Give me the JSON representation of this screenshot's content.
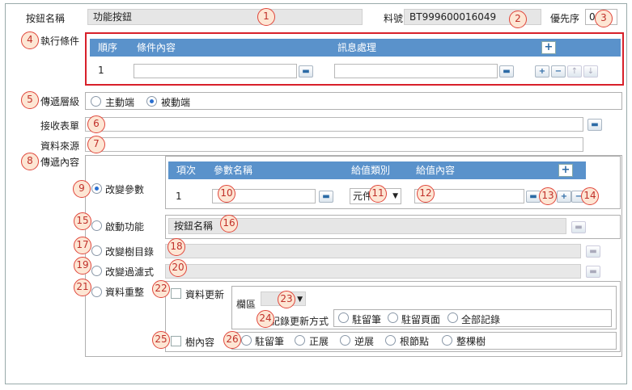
{
  "header": {
    "button_name_label": "按鈕名稱",
    "button_name_value": "功能按鈕",
    "material_no_label": "料號",
    "material_no_value": "BT999600016049",
    "priority_label": "優先序",
    "priority_value": "0"
  },
  "exec": {
    "label": "執行條件",
    "columns": [
      "順序",
      "條件內容",
      "訊息處理"
    ],
    "row_no": "1"
  },
  "layer": {
    "label": "傳遞層級",
    "options": [
      "主動端",
      "被動端"
    ]
  },
  "receive_form_label": "接收表單",
  "data_source_label": "資料來源",
  "content": {
    "label": "傳遞內容",
    "change_params": "改變參數",
    "param_columns": [
      "項次",
      "參數名稱",
      "給值類別",
      "給值內容"
    ],
    "param_row_no": "1",
    "value_type": "元件",
    "start_function": "啟動功能",
    "start_function_field": "按鈕名稱",
    "change_tree": "改變樹目錄",
    "change_filter": "改變過濾式",
    "data_reorg": "資料重整",
    "data_update": "資料更新",
    "section_label": "欄區",
    "record_update_label": "記錄更新方式",
    "record_options": [
      "駐留筆",
      "駐留頁面",
      "全部記錄"
    ],
    "tree_content": "樹內容",
    "tree_options": [
      "駐留筆",
      "正展",
      "逆展",
      "根節點",
      "整棵樹"
    ]
  },
  "callouts": [
    "1",
    "2",
    "3",
    "4",
    "5",
    "6",
    "7",
    "8",
    "9",
    "10",
    "11",
    "12",
    "13",
    "14",
    "15",
    "16",
    "17",
    "18",
    "19",
    "20",
    "21",
    "22",
    "23",
    "24",
    "25",
    "26"
  ]
}
